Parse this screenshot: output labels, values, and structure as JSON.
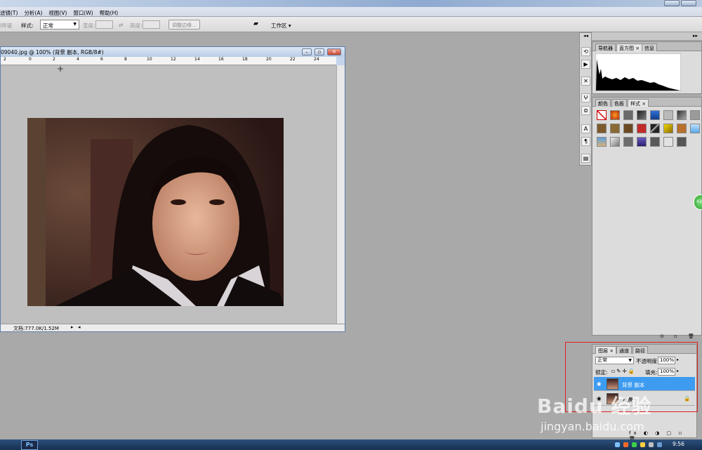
{
  "menu": {
    "items": [
      "滤镜(T)",
      "分析(A)",
      "视图(V)",
      "窗口(W)",
      "帮助(H)"
    ]
  },
  "options": {
    "prefix": "l降锯",
    "style_label": "样式:",
    "style_value": "正常",
    "width_label": "宽度:",
    "height_label": "高度:",
    "refine_edge": "调整边缘...",
    "workspace": "工作区"
  },
  "document": {
    "title": "09040.jpg @ 100% (背景 副本, RGB/8#)",
    "status": "文档:777.0K/1.52M",
    "ruler_ticks": [
      "2",
      "0",
      "2",
      "4",
      "6",
      "8",
      "10",
      "12",
      "14",
      "16",
      "18",
      "20",
      "22",
      "24"
    ]
  },
  "panels": {
    "top_tabs": [
      "导航器",
      "直方图",
      "信息"
    ],
    "styles_tabs": [
      "颜色",
      "色板",
      "样式"
    ],
    "layers_tabs": [
      "图层",
      "通道",
      "路径"
    ]
  },
  "layers": {
    "blend_mode": "正常",
    "opacity_label": "不透明度:",
    "opacity_value": "100%",
    "lock_label": "锁定:",
    "fill_label": "填充:",
    "fill_value": "100%",
    "items": [
      {
        "name": "背景 副本",
        "selected": true
      },
      {
        "name": "背景",
        "selected": false
      }
    ]
  },
  "watermark": {
    "logo": "Baidu 经验",
    "url": "jingyan.baidu.com"
  },
  "badge": "43",
  "taskbar": {
    "app": "Ps",
    "time": "9:56"
  },
  "colors": {
    "selected_layer": "#3d9bf0",
    "highlight_box": "#e02020",
    "workspace_gray": "#a9a9a9"
  }
}
